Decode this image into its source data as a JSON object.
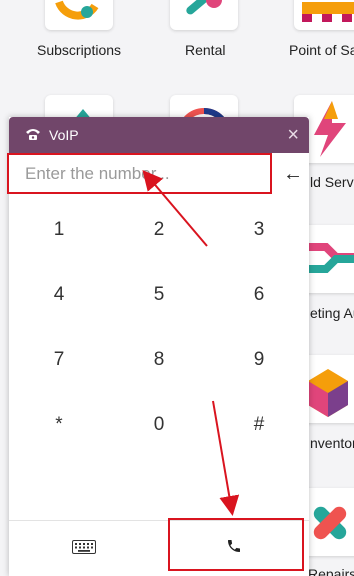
{
  "apps": [
    {
      "label": "Subscriptions",
      "icon": "subscriptions-icon"
    },
    {
      "label": "Rental",
      "icon": "rental-icon"
    },
    {
      "label": "Point of Sa",
      "icon": "point-of-sale-icon"
    },
    {
      "label": "ld Servic",
      "icon": "field-service-icon"
    },
    {
      "label": "eting Au",
      "icon": "marketing-automation-icon"
    },
    {
      "label": "nventor",
      "icon": "inventory-icon"
    },
    {
      "label": "Repairs",
      "icon": "repairs-icon"
    }
  ],
  "voip": {
    "title": "VoIP",
    "close_glyph": "×",
    "header_icon": "phone-icon",
    "input_placeholder": "Enter the number...",
    "input_value": "",
    "backspace_glyph": "←",
    "keys": [
      "1",
      "2",
      "3",
      "4",
      "5",
      "6",
      "7",
      "8",
      "9",
      "*",
      "0",
      "#"
    ],
    "keyboard_icon": "keyboard-icon",
    "call_icon": "call-icon"
  },
  "colors": {
    "header_bg": "#71466a",
    "highlight": "#d9141f"
  }
}
